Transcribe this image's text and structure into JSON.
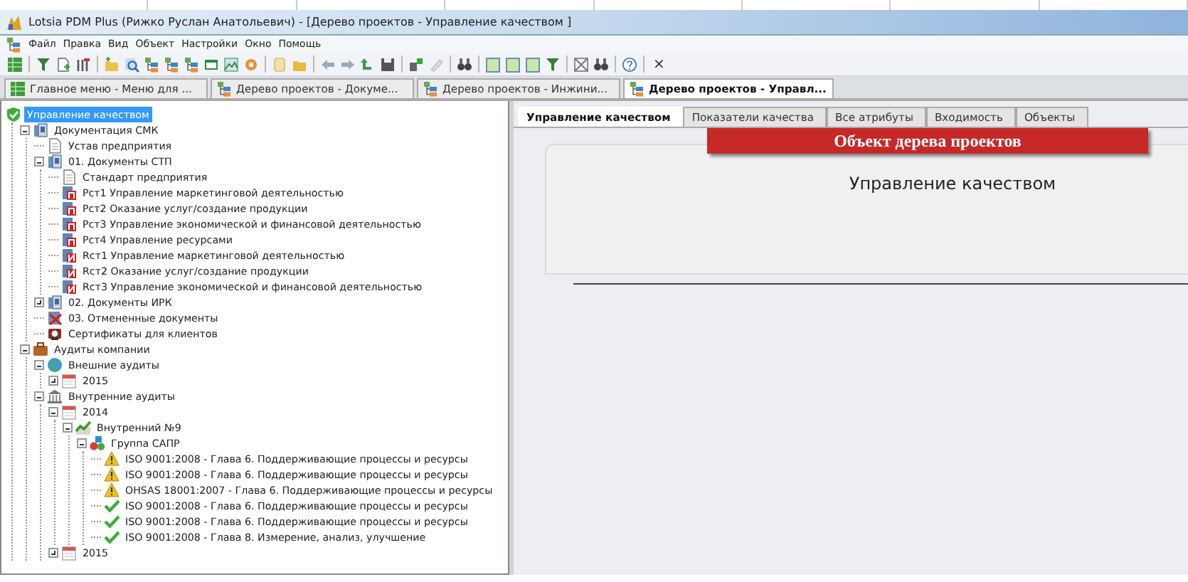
{
  "window": {
    "title": "Lotsia PDM Plus (Рижко Руслан Анатольевич) - [Дерево проектов - Управление качеством ]"
  },
  "menu": [
    "Файл",
    "Правка",
    "Вид",
    "Объект",
    "Настройки",
    "Окно",
    "Помощь"
  ],
  "toolbar": {
    "close_char": "×"
  },
  "doc_tabs": [
    {
      "label": "Главное меню - Меню для ...",
      "kind": "grid",
      "selected": false
    },
    {
      "label": "Дерево проектов - Докуме...",
      "kind": "tree",
      "selected": false
    },
    {
      "label": "Дерево проектов - Инжини...",
      "kind": "tree",
      "selected": false
    },
    {
      "label": "Дерево проектов - Управл...",
      "kind": "tree",
      "selected": true
    }
  ],
  "tree": [
    {
      "label": "Управление качеством",
      "kind": "shield",
      "selected": true,
      "children": [
        {
          "label": "Документация СМК",
          "kind": "binder",
          "selected": false,
          "expanded": true,
          "children": [
            {
              "label": "Устав предприятия",
              "kind": "doc",
              "selected": false
            },
            {
              "label": "01. Документы СТП",
              "kind": "binder",
              "selected": false,
              "expanded": true,
              "children": [
                {
                  "label": "Стандарт предприятия",
                  "kind": "doc",
                  "selected": false
                },
                {
                  "label": "Рст1 Управление маркетинговой деятельностью",
                  "kind": "binder-p",
                  "selected": false
                },
                {
                  "label": "Рст2 Оказание услуг/создание продукции",
                  "kind": "binder-p",
                  "selected": false
                },
                {
                  "label": "Рст3 Управление экономической и финансовой деятельностью",
                  "kind": "binder-p",
                  "selected": false
                },
                {
                  "label": "Рст4 Управление ресурсами",
                  "kind": "binder-p",
                  "selected": false
                },
                {
                  "label": "Rст1 Управление маркетинговой деятельностью",
                  "kind": "binder-i",
                  "selected": false
                },
                {
                  "label": "Rст2 Оказание услуг/создание продукции",
                  "kind": "binder-i",
                  "selected": false
                },
                {
                  "label": "Rст3 Управление экономической и финансовой деятельностью",
                  "kind": "binder-i",
                  "selected": false
                }
              ]
            },
            {
              "label": "02. Документы ИРК",
              "kind": "binder",
              "selected": false,
              "expanded": false
            },
            {
              "label": "03. Отмененные документы",
              "kind": "cancel",
              "selected": false
            },
            {
              "label": "Сертификаты для клиентов",
              "kind": "cert",
              "selected": false
            }
          ]
        },
        {
          "label": "Аудиты компании",
          "kind": "briefcase",
          "selected": false,
          "expanded": true,
          "children": [
            {
              "label": "Внешние аудиты",
              "kind": "globe",
              "selected": false,
              "expanded": true,
              "children": [
                {
                  "label": "2015",
                  "kind": "calendar",
                  "selected": false,
                  "expanded": false
                }
              ]
            },
            {
              "label": "Внутренние аудиты",
              "kind": "bank",
              "selected": false,
              "expanded": true,
              "children": [
                {
                  "label": "2014",
                  "kind": "calendar",
                  "selected": false,
                  "expanded": true,
                  "children": [
                    {
                      "label": "Внутренний №9",
                      "kind": "chart",
                      "selected": false,
                      "expanded": true,
                      "children": [
                        {
                          "label": "Группа САПР",
                          "kind": "group",
                          "selected": false,
                          "expanded": true,
                          "children": [
                            {
                              "label": "ISO 9001:2008 - Глава 6. Поддерживающие процессы и ресурсы",
                              "kind": "warning",
                              "selected": false
                            },
                            {
                              "label": "ISO 9001:2008 - Глава 6. Поддерживающие процессы и ресурсы",
                              "kind": "warning",
                              "selected": false
                            },
                            {
                              "label": "OHSAS 18001:2007 - Глава 6. Поддерживающие процессы и ресурсы",
                              "kind": "warning",
                              "selected": false
                            },
                            {
                              "label": "ISO 9001:2008 - Глава 6. Поддерживающие процессы и ресурсы",
                              "kind": "check",
                              "selected": false
                            },
                            {
                              "label": "ISO 9001:2008 - Глава 6. Поддерживающие процессы и ресурсы",
                              "kind": "check",
                              "selected": false
                            },
                            {
                              "label": "ISO 9001:2008 - Глава 8. Измерение, анализ, улучшение",
                              "kind": "check",
                              "selected": false
                            }
                          ]
                        }
                      ]
                    }
                  ]
                },
                {
                  "label": "2015",
                  "kind": "calendar",
                  "selected": false,
                  "expanded": false
                }
              ]
            }
          ]
        }
      ]
    }
  ],
  "detail_tabs": [
    {
      "label": "Управление качеством",
      "selected": true
    },
    {
      "label": "Показатели качества",
      "selected": false
    },
    {
      "label": "Все атрибуты",
      "selected": false
    },
    {
      "label": "Входимость",
      "selected": false
    },
    {
      "label": "Объекты",
      "selected": false
    }
  ],
  "detail": {
    "banner": "Объект дерева проектов",
    "title": "Управление качеством"
  }
}
